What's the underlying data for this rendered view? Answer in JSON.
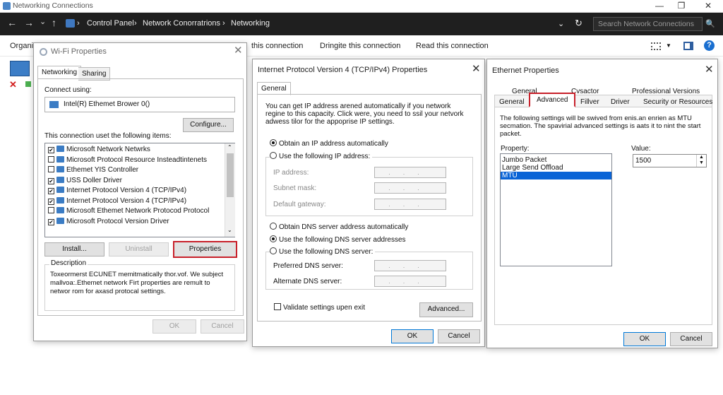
{
  "window": {
    "title": "Networking Connections",
    "min": "—",
    "max": "❐",
    "close": "✕"
  },
  "address": {
    "back": "←",
    "forward": "→",
    "down": "⌄",
    "up": "↑",
    "crumbs": [
      "Control Panel",
      "Network Conorratrions",
      "Networking"
    ],
    "sep": "›",
    "refresh": "↻",
    "dropdown": "⌄",
    "search_placeholder": "Search Network Connections",
    "search_icon": "🔍"
  },
  "cmdbar": {
    "organize": "Organi",
    "items": [
      "this connection",
      "Dringite this connection",
      "Read this connection"
    ],
    "help": "?"
  },
  "wifi": {
    "title": "Wi-Fi Properties",
    "close": "✕",
    "tabs": [
      "Networking",
      "Sharing"
    ],
    "connect_label": "Connect using:",
    "adapter": "Intel(R) Ethemet Brower 0()",
    "configure": "Configure...",
    "items_label": "This connection uset the following items:",
    "items": [
      {
        "label": "Microsoft Network Netwrks",
        "checked": true,
        "mark": "✔"
      },
      {
        "label": "Microsoft Protocol Resource Insteadtintenets",
        "checked": false,
        "mark": ""
      },
      {
        "label": "Ethemet YIS Controller",
        "checked": false,
        "mark": ""
      },
      {
        "label": "USS Doller Driver",
        "checked": true,
        "mark": "✔"
      },
      {
        "label": "Internet Protocol Version 4 (TCP/IPv4)",
        "checked": true,
        "mark": "✔"
      },
      {
        "label": "Internet Protocol Version 4 (TCP/IPv4)",
        "checked": true,
        "mark": "✔"
      },
      {
        "label": "Microsoft Ethemet Network Protocod Protocol",
        "checked": false,
        "mark": ""
      },
      {
        "label": "Microsoft Protocol Version Driver",
        "checked": true,
        "mark": "✔"
      }
    ],
    "install": "Install...",
    "uninstall": "Uninstall",
    "properties": "Properties",
    "desc_label": "Description",
    "desc_text": "Toxeormerst ECUNET memitmatically thor.vof. We subject mallvoa:.Ethemet network Firt properties are remult to networ rom for axasd protocal settings.",
    "ok": "OK",
    "cancel": "Cancel"
  },
  "ipv4": {
    "title": "Internet Protocol Version 4 (TCP/IPv4) Properties",
    "close": "✕",
    "tab": "General",
    "intro": "You can get IP address arened automatically if you network regine to this capacity. Click were, you need to ssil your netvork adwess tilor for the appoprise IP settings.",
    "obtain_ip": "Obtain an IP address automatically",
    "use_ip": "Use the following IP address:",
    "ip_label": "IP address:",
    "subnet_label": "Subnet mask:",
    "gateway_label": "Default gateway:",
    "ip_dots": "...",
    "obtain_dns": "Obtain DNS server address automatically",
    "use_dns_addr": "Use the following DNS server addresses",
    "use_dns": "Use the following DNS server:",
    "preferred": "Preferred DNS server:",
    "alternate": "Alternate DNS server:",
    "validate": "Validate settings upen exit",
    "advanced": "Advanced...",
    "ok": "OK",
    "cancel": "Cancel"
  },
  "ether": {
    "title": "Ethernet Properties",
    "close": "✕",
    "tabs_row1": [
      "General",
      "Cvsactor",
      "Professional Versions"
    ],
    "tabs_row2": [
      "General",
      "Advanced",
      "Fillver",
      "Driver",
      "Security or Resources"
    ],
    "info": "The following settings will be swived from enis.an enrien as MTU secmation. The spavirial advanced settings is aats it to nint the start packet.",
    "property_label": "Property:",
    "value_label": "Value:",
    "properties": [
      "Jumbo Packet",
      "Large Send Offload",
      "MTU"
    ],
    "selected": "MTU",
    "value": "1500",
    "ok": "OK",
    "cancel": "Cancel"
  }
}
